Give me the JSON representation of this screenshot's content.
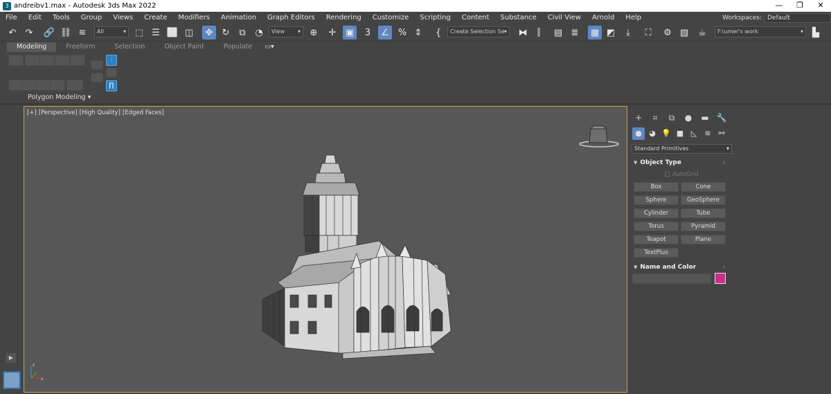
{
  "window": {
    "title": "andreibv1.max - Autodesk 3ds Max 2022",
    "controls": [
      "—",
      "❐",
      "✕"
    ]
  },
  "menu": [
    "File",
    "Edit",
    "Tools",
    "Group",
    "Views",
    "Create",
    "Modifiers",
    "Animation",
    "Graph Editors",
    "Rendering",
    "Customize",
    "Scripting",
    "Content",
    "Substance",
    "Civil View",
    "Arnold",
    "Help"
  ],
  "workspaces": {
    "label": "Workspaces:",
    "value": "Default"
  },
  "toolbar": {
    "selection_filter": "All",
    "ref_coord": "View",
    "named_selection": "Create Selection Se",
    "project_path": "F:\\umer's work"
  },
  "ribbon": {
    "tabs": [
      "Modeling",
      "Freeform",
      "Selection",
      "Object Paint",
      "Populate"
    ],
    "active_tab": "Modeling",
    "panel_label": "Polygon Modeling ▾"
  },
  "viewport": {
    "labels": [
      "[+]",
      "[Perspective]",
      "[High Quality]",
      "[Edged Faces]"
    ]
  },
  "command_panel": {
    "dropdown": "Standard Primitives",
    "object_type": {
      "title": "Object Type",
      "autogrid": "AutoGrid",
      "buttons": [
        "Box",
        "Cone",
        "Sphere",
        "GeoSphere",
        "Cylinder",
        "Tube",
        "Torus",
        "Pyramid",
        "Teapot",
        "Plane",
        "TextPlus"
      ]
    },
    "name_and_color": {
      "title": "Name and Color",
      "name_value": "",
      "color": "#c9308a"
    }
  },
  "colors": {
    "ui_background": "#444444",
    "viewport_background": "#575757",
    "active_viewport_border": "#c7a34d",
    "highlight": "#5e88c4"
  }
}
